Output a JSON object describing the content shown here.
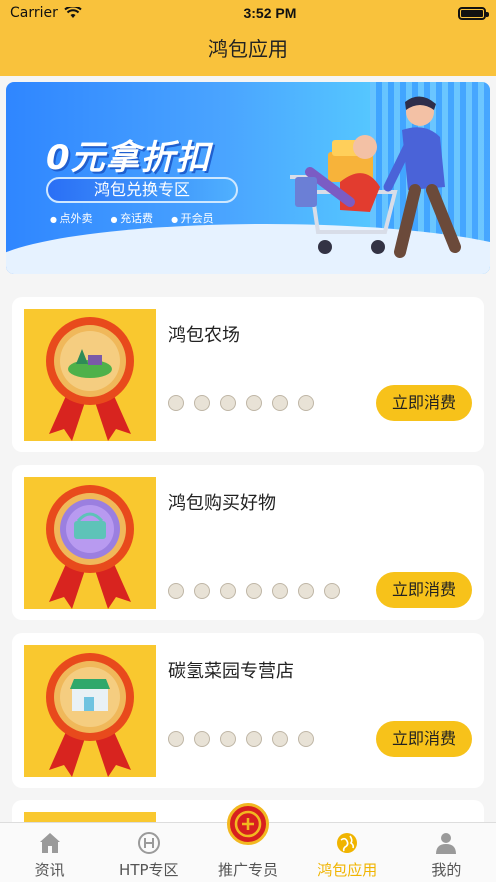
{
  "status": {
    "carrier": "Carrier",
    "time": "3:52 PM"
  },
  "nav": {
    "title": "鸿包应用"
  },
  "banner": {
    "headline": "0元拿折扣",
    "pill": "鸿包兑换专区",
    "tags": [
      "点外卖",
      "充话费",
      "开会员"
    ]
  },
  "cards": [
    {
      "name": "鸿包农场",
      "button": "立即消费"
    },
    {
      "name": "鸿包购买好物",
      "button": "立即消费"
    },
    {
      "name": "碳氢菜园专营店",
      "button": "立即消费"
    }
  ],
  "tabs": [
    {
      "label": "资讯",
      "icon": "home-icon"
    },
    {
      "label": "HTP专区",
      "icon": "htp-icon"
    },
    {
      "label": "推广专员",
      "icon": "promoter-badge-icon"
    },
    {
      "label": "鸿包应用",
      "icon": "globe-icon",
      "active": true
    },
    {
      "label": "我的",
      "icon": "user-icon"
    }
  ],
  "colors": {
    "brand": "#f9c23c",
    "button": "#f7c21a",
    "active_tab": "#f0b400"
  }
}
